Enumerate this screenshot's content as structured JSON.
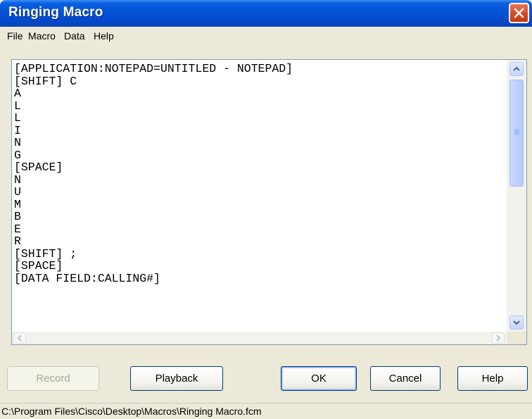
{
  "window": {
    "title": "Ringing Macro"
  },
  "menu": {
    "items": [
      "File",
      "Macro",
      "Data",
      "Help"
    ]
  },
  "editor": {
    "lines": [
      "[APPLICATION:NOTEPAD=UNTITLED - NOTEPAD]",
      "[SHIFT] C",
      "A",
      "L",
      "L",
      "I",
      "N",
      "G",
      "[SPACE]",
      "N",
      "U",
      "M",
      "B",
      "E",
      "R",
      "[SHIFT] ;",
      "[SPACE]",
      "[DATA FIELD:CALLING#]"
    ]
  },
  "buttons": {
    "record": "Record",
    "playback": "Playback",
    "ok": "OK",
    "cancel": "Cancel",
    "help": "Help"
  },
  "status": {
    "path": "C:\\Program Files\\Cisco\\Desktop\\Macros\\Ringing Macro.fcm"
  },
  "icons": {
    "close": "close-icon",
    "scroll_up": "arrow-up-icon",
    "scroll_down": "arrow-down-icon",
    "scroll_left": "arrow-left-icon",
    "scroll_right": "arrow-right-icon"
  },
  "colors": {
    "titlebar": "#0553d8",
    "close_button": "#d44a22",
    "face": "#ece9d8"
  }
}
